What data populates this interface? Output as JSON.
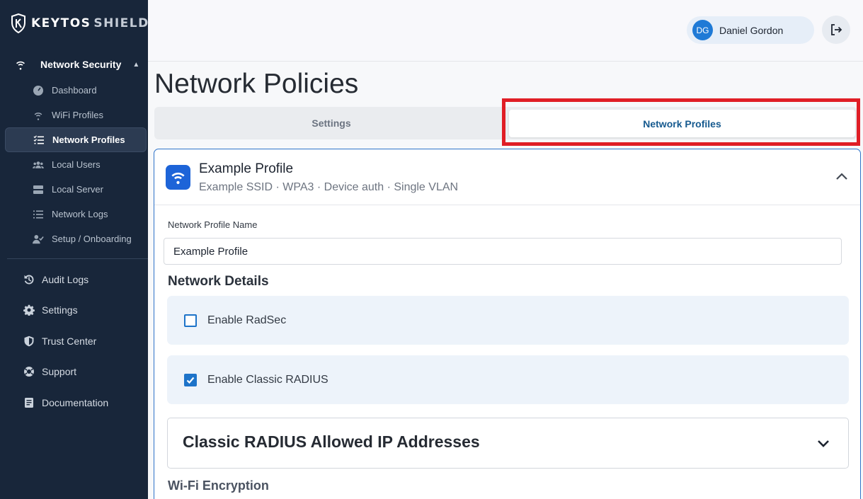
{
  "brand": {
    "name": "KEYTOS",
    "product": "SHIELD"
  },
  "sidebar": {
    "group_label": "Network Security",
    "sub_items": [
      {
        "label": "Dashboard",
        "icon": "dashboard-icon"
      },
      {
        "label": "WiFi Profiles",
        "icon": "wifi-icon"
      },
      {
        "label": "Network Profiles",
        "icon": "list-check-icon",
        "active": true
      },
      {
        "label": "Local Users",
        "icon": "users-icon"
      },
      {
        "label": "Local Server",
        "icon": "server-icon"
      },
      {
        "label": "Network Logs",
        "icon": "list-icon"
      },
      {
        "label": "Setup / Onboarding",
        "icon": "user-check-icon"
      }
    ],
    "items": [
      {
        "label": "Audit Logs",
        "icon": "history-icon"
      },
      {
        "label": "Settings",
        "icon": "gear-icon"
      },
      {
        "label": "Trust Center",
        "icon": "shield-icon"
      },
      {
        "label": "Support",
        "icon": "lifebuoy-icon"
      },
      {
        "label": "Documentation",
        "icon": "book-icon"
      }
    ]
  },
  "header": {
    "user_initials": "DG",
    "user_name": "Daniel Gordon",
    "logout_icon": "logout-icon"
  },
  "main": {
    "title": "Network Policies",
    "tabs": [
      {
        "label": "Settings",
        "active": false
      },
      {
        "label": "Network Profiles",
        "active": true
      }
    ],
    "highlight_color": "#e01e26"
  },
  "profile": {
    "name": "Example Profile",
    "summary": "Example SSID · WPA3 · Device auth · Single VLAN",
    "name_field_label": "Network Profile Name",
    "name_field_value": "Example Profile",
    "network_details_title": "Network Details",
    "options": [
      {
        "label": "Enable RadSec",
        "checked": false
      },
      {
        "label": "Enable Classic RADIUS",
        "checked": true
      }
    ],
    "accordion_title": "Classic RADIUS Allowed IP Addresses",
    "next_section_title": "Wi-Fi Encryption"
  },
  "colors": {
    "sidebar_bg": "#18263a",
    "accent": "#1d73c9",
    "active_tab_text": "#165a8f"
  }
}
